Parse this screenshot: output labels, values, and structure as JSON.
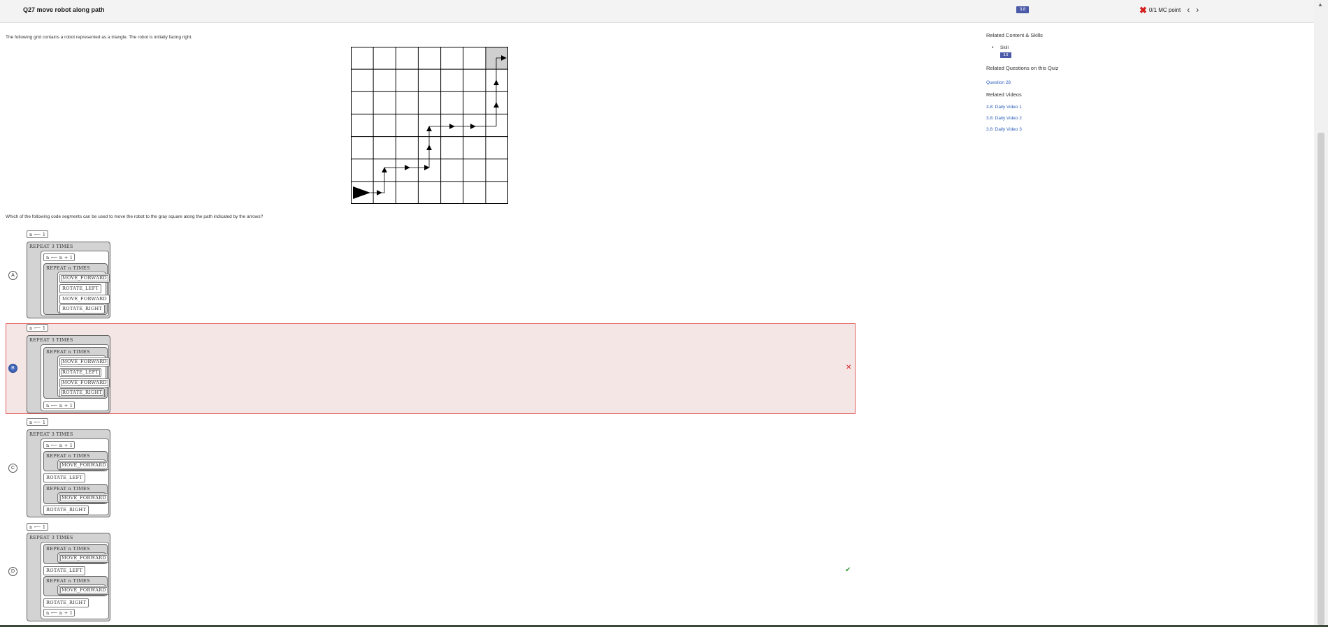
{
  "header": {
    "title": "Q27 move robot along path",
    "badge": "3.8",
    "score": "0/1 MC point",
    "prev": "‹",
    "next": "›"
  },
  "prompt": "The following grid contains a robot represented as a triangle. The robot is initially facing right.",
  "question": "Which of the following code segments can be used to move the robot to the gray square along the path indicated by the arrows?",
  "options": [
    {
      "letter": "A"
    },
    {
      "letter": "B"
    },
    {
      "letter": "C"
    },
    {
      "letter": "D"
    }
  ],
  "code": {
    "assign_init": "n ⟵ 1",
    "repeat_3": "REPEAT 3 TIMES",
    "repeat_n": "REPEAT n TIMES",
    "increment": "n ⟵ n + 1",
    "move_forward": "MOVE_FORWARD",
    "rotate_left": "ROTATE_LEFT",
    "rotate_right": "ROTATE_RIGHT"
  },
  "marks": {
    "wrong": "✕",
    "correct": "✔"
  },
  "sidebar": {
    "related_content": "Related Content & Skills",
    "skill": "Skill",
    "skill_badge": "3.8",
    "related_questions": "Related Questions on this Quiz",
    "question_link": "Question 28",
    "related_videos": "Related Videos",
    "videos": [
      "3.8: Daily Video 1",
      "3.8: Daily Video 2",
      "3.8: Daily Video 3"
    ]
  }
}
